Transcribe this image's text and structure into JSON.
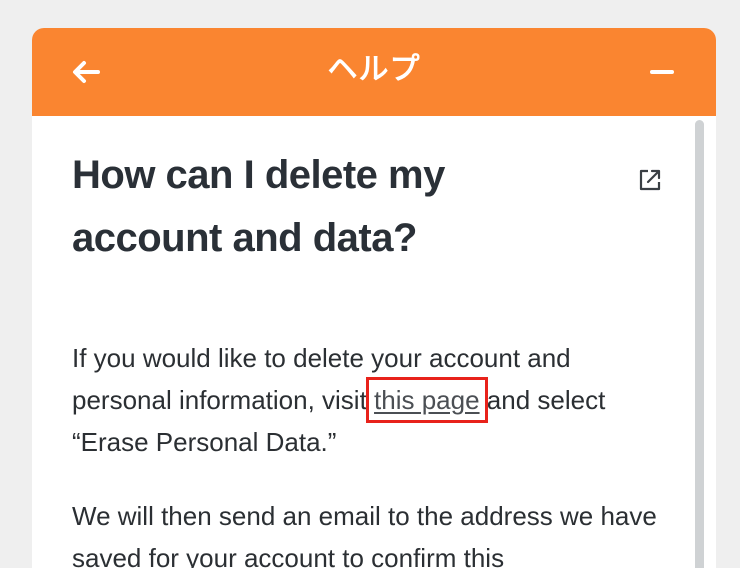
{
  "header": {
    "title": "ヘルプ",
    "back_icon": "arrow-left-icon",
    "minimize_icon": "minus-icon",
    "background_color": "#fa8530"
  },
  "article": {
    "title": "How can I delete my account and data?",
    "external_icon": "external-link-icon",
    "paragraph1": {
      "before": "If you would like to delete your account and personal information, visit ",
      "link": "this page",
      "after": " and select “Erase Personal Data.”"
    },
    "paragraph2": "We will then send an email to the address we have saved for your account to confirm this"
  },
  "colors": {
    "highlight": "#e8221b",
    "text": "#2b2f33"
  }
}
